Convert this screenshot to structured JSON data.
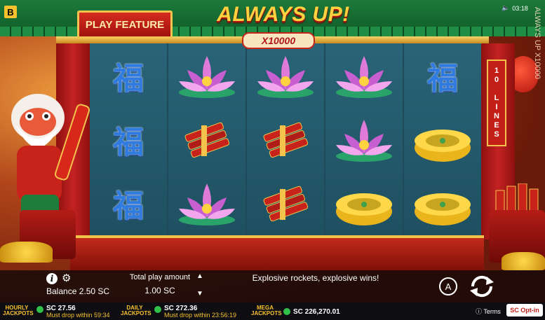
{
  "game": {
    "brand_letter": "B",
    "title": "ALWAYS UP!",
    "multiplier": "X10000",
    "side_title": "ALWAYS UP X10000",
    "clock": "03:18",
    "play_feature_label": "PLAY FEATURE",
    "lines_label": "10 LINES"
  },
  "reels": [
    [
      "fu-symbol",
      "fu-symbol",
      "fu-symbol"
    ],
    [
      "lotus-symbol",
      "firecracker-symbol",
      "lotus-symbol"
    ],
    [
      "lotus-symbol",
      "firecracker-symbol",
      "firecracker-symbol"
    ],
    [
      "lotus-symbol",
      "lotus-symbol",
      "gold-ingot-symbol"
    ],
    [
      "fu-symbol",
      "gold-ingot-symbol",
      "gold-ingot-symbol"
    ]
  ],
  "symbol_text": {
    "fu": "福"
  },
  "controls": {
    "balance": "Balance 2.50 SC",
    "total_play_label": "Total play amount",
    "total_play_value": "1.00 SC",
    "message": "Explosive rockets, explosive wins!",
    "auto_label": "A",
    "up_arrow": "▲",
    "down_arrow": "▼"
  },
  "jackpots": [
    {
      "name_top": "HOURLY",
      "name_bottom": "JACKPOTS",
      "amount": "SC 27.56",
      "drop": "Must drop within 59:34"
    },
    {
      "name_top": "DAILY",
      "name_bottom": "JACKPOTS",
      "amount": "SC 272.36",
      "drop": "Must drop within 23:56:19"
    },
    {
      "name_top": "MEGA",
      "name_bottom": "JACKPOTS",
      "amount": "SC 226,270.01",
      "drop": ""
    }
  ],
  "footer": {
    "terms": "Terms",
    "opt_in": "SC Opt-in"
  },
  "colors": {
    "accent_gold": "#f6c12d",
    "jackpot_coin": "#31c14b",
    "opt_in_red": "#c0201a"
  }
}
